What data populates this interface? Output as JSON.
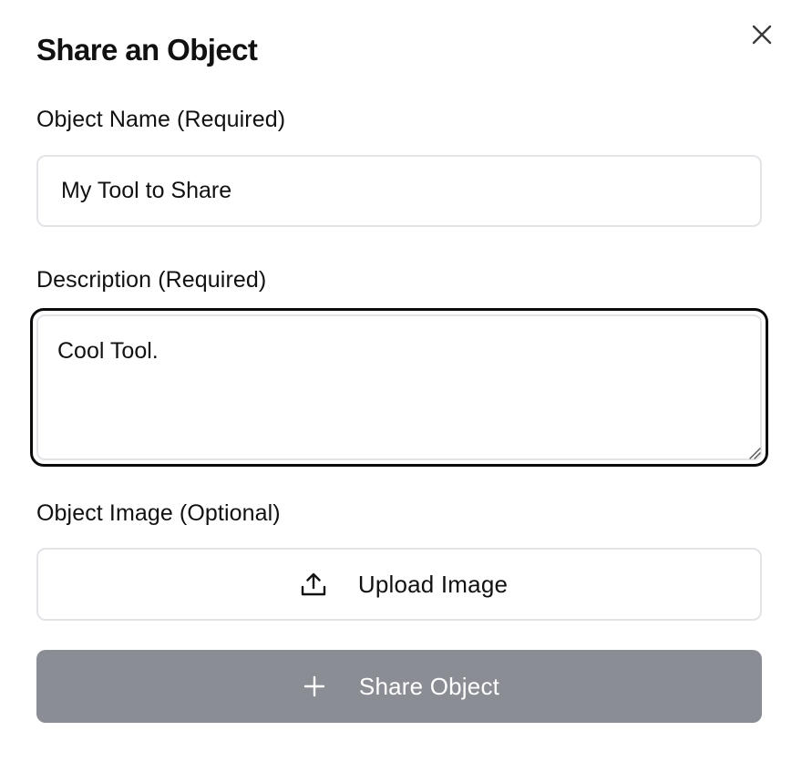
{
  "dialog": {
    "title": "Share an Object",
    "close_icon": "close-icon"
  },
  "fields": {
    "name": {
      "label": "Object Name (Required)",
      "value": "My Tool to Share"
    },
    "description": {
      "label": "Description (Required)",
      "value": "Cool Tool."
    },
    "image": {
      "label": "Object Image (Optional)"
    }
  },
  "buttons": {
    "upload": {
      "label": "Upload Image",
      "icon": "upload-icon"
    },
    "share": {
      "label": "Share Object",
      "icon": "plus-icon",
      "state": "disabled"
    }
  },
  "colors": {
    "focus_border": "#0b0b0b",
    "input_border": "#e2e4e8",
    "share_button_bg": "#8a8d94",
    "text": "#111111"
  }
}
